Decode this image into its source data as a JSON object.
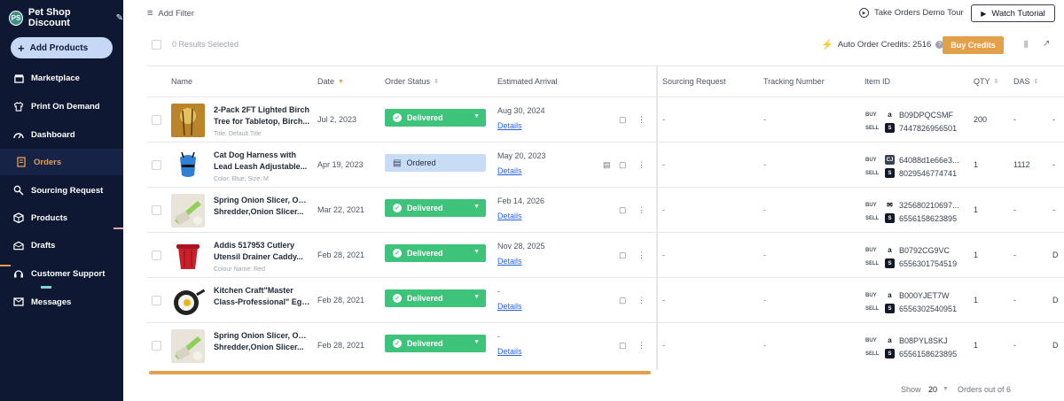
{
  "sidebar": {
    "avatar": "PS",
    "store_name": "Pet Shop Discount",
    "add_products": "Add Products",
    "items": [
      {
        "label": "Marketplace",
        "icon": "store-icon"
      },
      {
        "label": "Print On Demand",
        "icon": "shirt-icon"
      },
      {
        "label": "Dashboard",
        "icon": "gauge-icon"
      },
      {
        "label": "Orders",
        "icon": "orders-icon"
      },
      {
        "label": "Sourcing Request",
        "icon": "sourcing-icon"
      },
      {
        "label": "Products",
        "icon": "box-icon"
      },
      {
        "label": "Drafts",
        "icon": "drafts-icon"
      },
      {
        "label": "Customer Support",
        "icon": "headset-icon"
      },
      {
        "label": "Messages",
        "icon": "mail-icon"
      }
    ],
    "active": "Orders",
    "colors": {
      "bg": "#0f1833",
      "accent": "#e3a04a"
    }
  },
  "topbar": {
    "add_filter": "Add Filter",
    "demo_tour": "Take Orders Demo Tour",
    "watch_tutorial": "Watch Tutorial"
  },
  "selection": {
    "selected_text": "0 Results Selected",
    "credits_label": "Auto Order Credits: 2516",
    "buy_credits": "Buy Credits"
  },
  "table": {
    "headers": {
      "name": "Name",
      "date": "Date",
      "order_status": "Order Status",
      "estimated_arrival": "Estimated Arrival",
      "sourcing_request": "Sourcing Request",
      "tracking_number": "Tracking Number",
      "item_id": "Item ID",
      "qty": "QTY",
      "das": "DAS"
    },
    "buy_tag": "BUY",
    "sell_tag": "SELL",
    "details_label": "Details",
    "rows": [
      {
        "line1": "2-Pack 2FT Lighted Birch",
        "line2": "Tree for Tabletop, Birch...",
        "variant": "Title: Default Title",
        "date": "Jul 2, 2023",
        "status": "Delivered",
        "arrival": "Aug 30, 2024",
        "sourcing": "-",
        "tracking": "-",
        "buy_id": "B09DPQCSMF",
        "buy_market": "amazon",
        "sell_id": "7447826956501",
        "qty": "200",
        "das": "-",
        "edge": "-"
      },
      {
        "line1": "Cat Dog Harness with",
        "line2": "Lead Leash Adjustable...",
        "variant": "Color: Blue, Size: M",
        "date": "Apr 19, 2023",
        "status": "Ordered",
        "arrival": "May 20, 2023",
        "sourcing": "-",
        "tracking": "-",
        "buy_id": "64088d1e66e3...",
        "buy_market": "cj",
        "sell_id": "8029546774741",
        "qty": "1",
        "das": "1112",
        "edge": "-"
      },
      {
        "line1": "Spring Onion Slicer, Onion",
        "line2": "Shredder,Onion Slicer...",
        "variant": "",
        "date": "Mar 22, 2021",
        "status": "Delivered",
        "arrival": "Feb 14, 2026",
        "sourcing": "-",
        "tracking": "-",
        "buy_id": "325680210697...",
        "buy_market": "email",
        "sell_id": "6556158623895",
        "qty": "1",
        "das": "-",
        "edge": "-"
      },
      {
        "line1": "Addis 517953 Cutlery",
        "line2": "Utensil Drainer Caddy...",
        "variant": "Colour Name: Red",
        "date": "Feb 28, 2021",
        "status": "Delivered",
        "arrival": "Nov 28, 2025",
        "sourcing": "-",
        "tracking": "-",
        "buy_id": "B0792CG9VC",
        "buy_market": "amazon",
        "sell_id": "6556301754519",
        "qty": "1",
        "das": "-",
        "edge": "D"
      },
      {
        "line1": "Kitchen Craft\"Master",
        "line2": "Class-Professional\" Egg...",
        "variant": "",
        "date": "Feb 28, 2021",
        "status": "Delivered",
        "arrival": "-",
        "sourcing": "-",
        "tracking": "-",
        "buy_id": "B000YJET7W",
        "buy_market": "amazon",
        "sell_id": "6556302540951",
        "qty": "1",
        "das": "-",
        "edge": "D"
      },
      {
        "line1": "Spring Onion Slicer, Onion",
        "line2": "Shredder,Onion Slicer...",
        "variant": "",
        "date": "Feb 28, 2021",
        "status": "Delivered",
        "arrival": "-",
        "sourcing": "-",
        "tracking": "-",
        "buy_id": "B08PYL8SKJ",
        "buy_market": "amazon",
        "sell_id": "6556158623895",
        "qty": "1",
        "das": "-",
        "edge": "D"
      }
    ]
  },
  "footer": {
    "show_label": "Show",
    "show_value": "20",
    "orders_count": "Orders out of 6"
  },
  "colors": {
    "delivered": "#3ec47a",
    "ordered": "#c8dcf6",
    "link": "#2563eb"
  }
}
